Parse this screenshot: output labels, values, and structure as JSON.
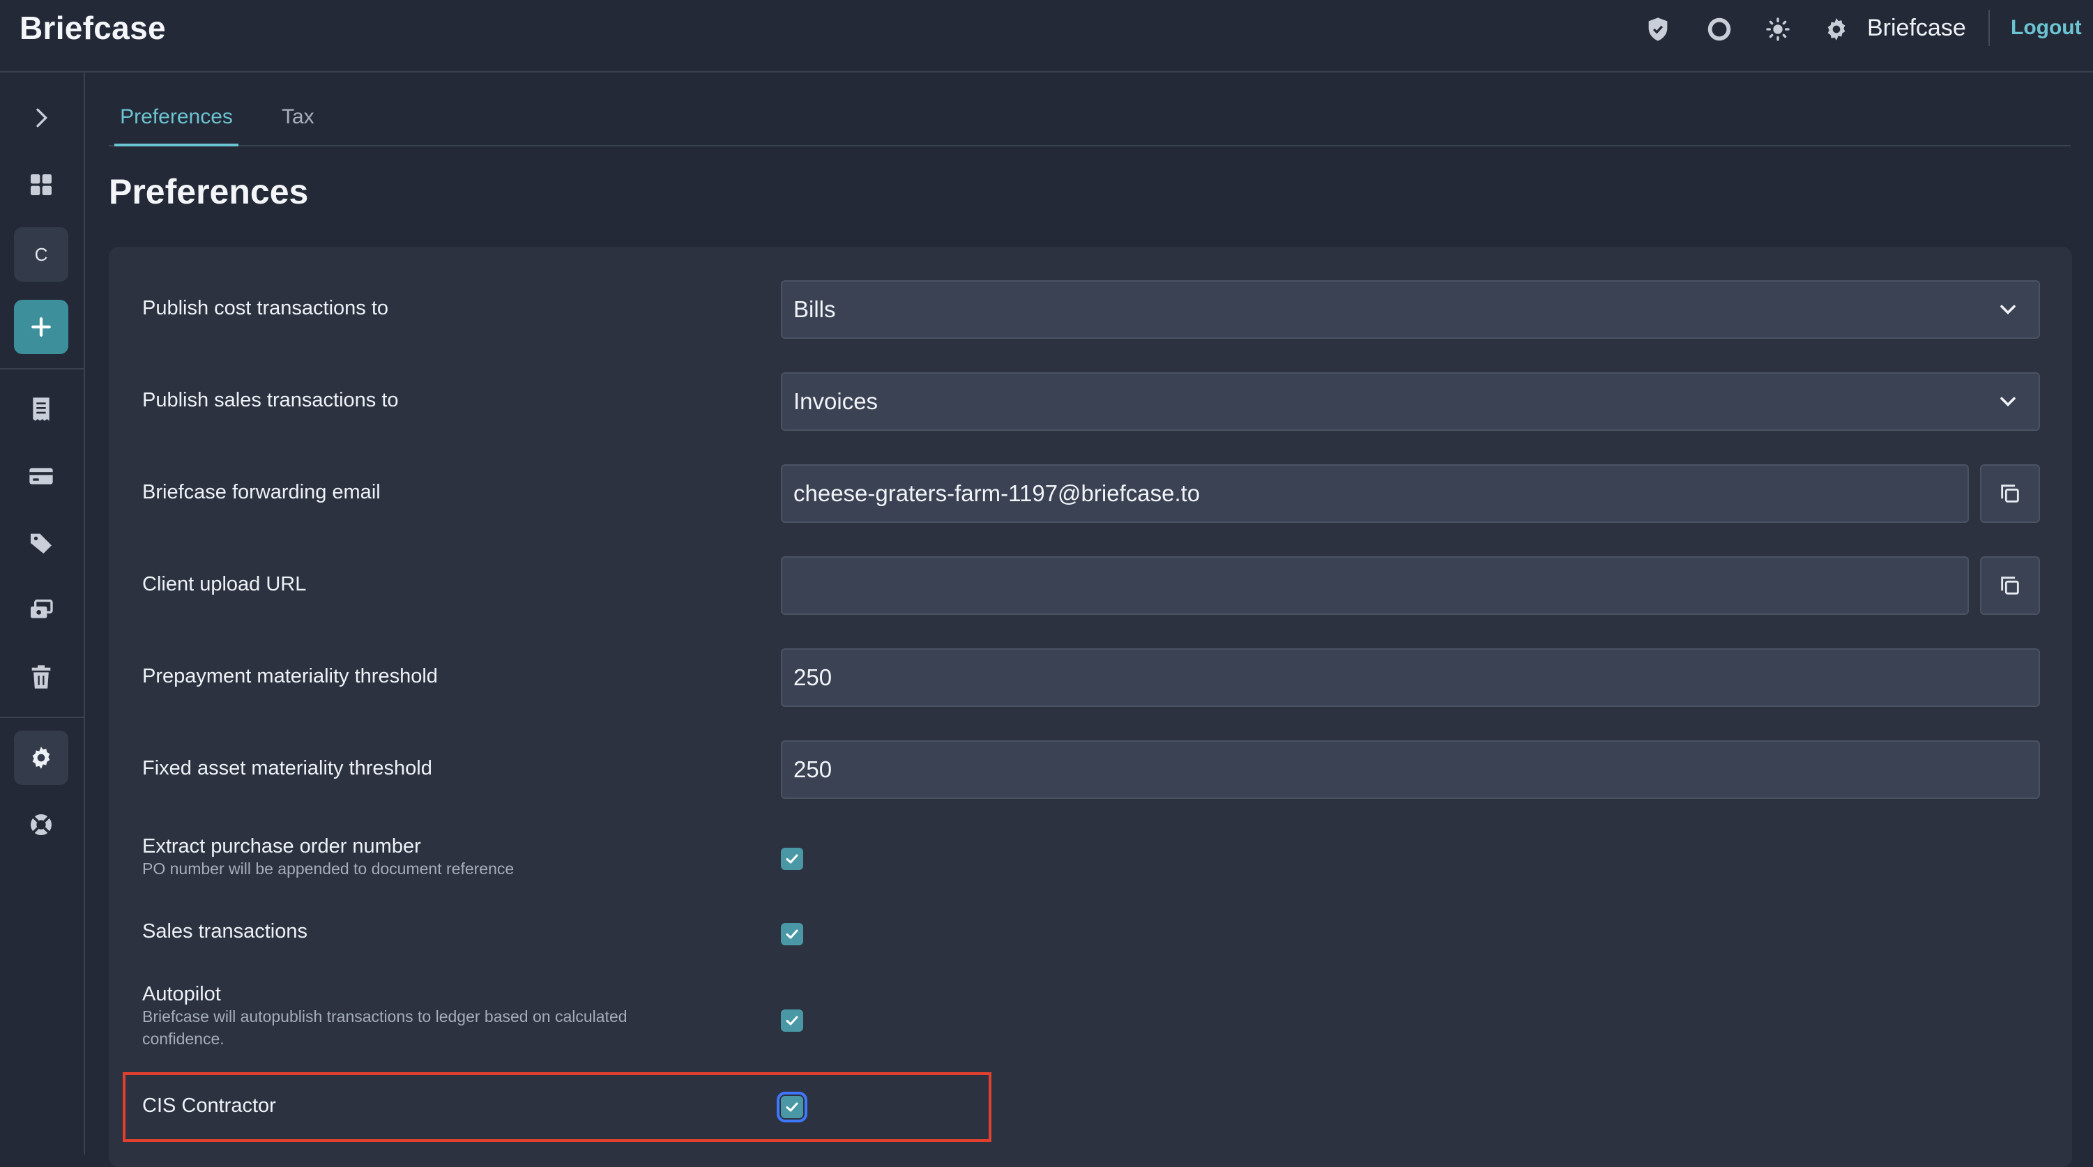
{
  "header": {
    "brand": "Briefcase",
    "user_name": "Briefcase",
    "logout_label": "Logout"
  },
  "sidebar": {
    "company_initial": "C"
  },
  "tabs": [
    {
      "label": "Preferences",
      "active": true
    },
    {
      "label": "Tax",
      "active": false
    }
  ],
  "page_title": "Preferences",
  "form": {
    "publish_cost": {
      "label": "Publish cost transactions to",
      "value": "Bills"
    },
    "publish_sales": {
      "label": "Publish sales transactions to",
      "value": "Invoices"
    },
    "forwarding_email": {
      "label": "Briefcase forwarding email",
      "value": "cheese-graters-farm-1197@briefcase.to"
    },
    "client_upload": {
      "label": "Client upload URL",
      "value": ""
    },
    "prepayment_threshold": {
      "label": "Prepayment materiality threshold",
      "value": "250"
    },
    "fixed_asset_threshold": {
      "label": "Fixed asset materiality threshold",
      "value": "250"
    },
    "extract_po": {
      "label": "Extract purchase order number",
      "sub": "PO number will be appended to document reference",
      "checked": true
    },
    "sales_transactions": {
      "label": "Sales transactions",
      "checked": true
    },
    "autopilot": {
      "label": "Autopilot",
      "sub_line1": "Briefcase will autopublish transactions to ledger based on calculated",
      "sub_line2": "confidence.",
      "checked": true
    },
    "cis_contractor": {
      "label": "CIS Contractor",
      "checked": true
    }
  },
  "colors": {
    "accent": "#6cc3d2",
    "checkbox": "#4a98a6",
    "add_button": "#3d8f9c",
    "highlight": "#e0402e",
    "background": "#232936",
    "panel": "#2c3240"
  }
}
